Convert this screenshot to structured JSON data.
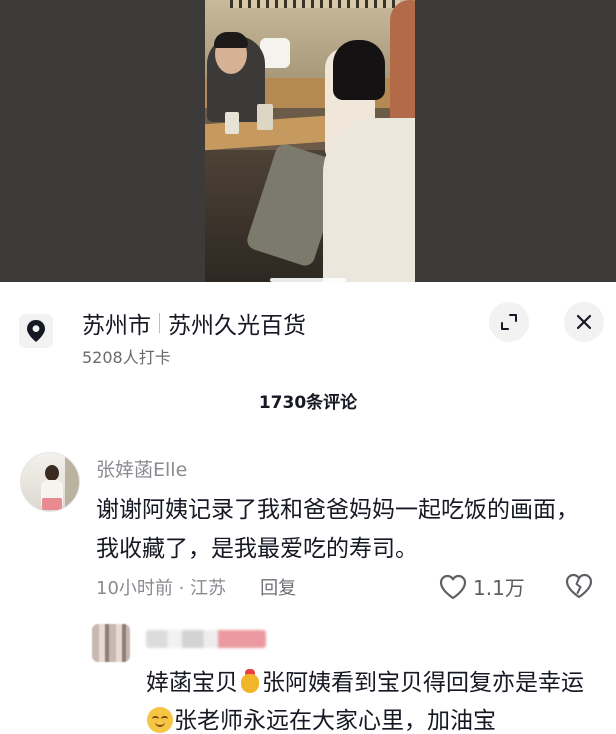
{
  "location": {
    "city": "苏州市",
    "place": "苏州久光百货",
    "checkins": "5208人打卡"
  },
  "comments_header": "1730条评论",
  "comment": {
    "author": "张婞菡Elle",
    "text": "谢谢阿姨记录了我和爸爸妈妈一起吃饭的画面，我收藏了，是我最爱吃的寿司。",
    "time_place": "10小时前 · 江苏",
    "reply_label": "回复",
    "likes": "1.1万"
  },
  "reply": {
    "text_part1": "婞菡宝贝",
    "text_part2": "张阿姨看到宝贝得回复亦是幸运",
    "text_part3": "张老师永远在大家心里，加油宝"
  },
  "icons": {
    "location": "location-pin-icon",
    "expand": "expand-icon",
    "close": "close-icon",
    "like": "heart-outline-icon",
    "dislike": "broken-heart-icon",
    "emoji1": "lucky-bag-emoji",
    "emoji2": "shy-smile-emoji"
  }
}
